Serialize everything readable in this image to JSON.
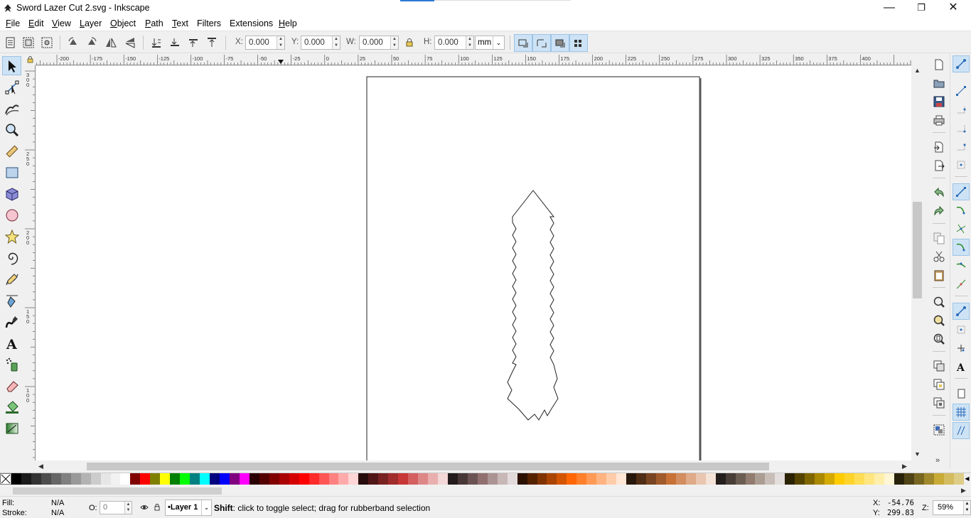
{
  "window": {
    "title": "Sword Lazer Cut 2.svg - Inkscape",
    "minimize_glyph": "—",
    "maximize_glyph": "❐",
    "close_glyph": "✕"
  },
  "menu": [
    {
      "label": "File",
      "key": "F",
      "rest": "ile"
    },
    {
      "label": "Edit",
      "key": "E",
      "rest": "dit"
    },
    {
      "label": "View",
      "key": "V",
      "rest": "iew"
    },
    {
      "label": "Layer",
      "key": "L",
      "rest": "ayer"
    },
    {
      "label": "Object",
      "key": "O",
      "rest": "bject"
    },
    {
      "label": "Path",
      "key": "P",
      "rest": "ath"
    },
    {
      "label": "Text",
      "key": "T",
      "rest": "ext"
    },
    {
      "label": "Filters",
      "key": "",
      "rest": "Filters"
    },
    {
      "label": "Extensions",
      "key": "",
      "rest": "Extensions"
    },
    {
      "label": "Help",
      "key": "H",
      "rest": "elp"
    }
  ],
  "toolbar": {
    "x_label": "X:",
    "x_value": "0.000",
    "y_label": "Y:",
    "y_value": "0.000",
    "w_label": "W:",
    "w_value": "0.000",
    "h_label": "H:",
    "h_value": "0.000",
    "unit": "mm",
    "spin_arrows": "▲\n▼",
    "dropdown_glyph": "⌄"
  },
  "rulers": {
    "h_ticks": [
      "-200",
      "-175",
      "-150",
      "-125",
      "-100",
      "-75",
      "-50",
      "-25",
      "0",
      "25",
      "50",
      "75",
      "100",
      "125",
      "150",
      "175",
      "200",
      "225",
      "250",
      "275",
      "300",
      "325",
      "350",
      "375",
      "400"
    ],
    "v_ticks": [
      "300",
      "250",
      "200",
      "150",
      "100"
    ]
  },
  "scroll": {
    "up": "▲",
    "down": "▼",
    "left": "◀",
    "right": "▶"
  },
  "toolbox_more": "»",
  "cmd_more": "»",
  "palette": {
    "colors": [
      "#000000",
      "#1a1a1a",
      "#333333",
      "#4d4d4d",
      "#666666",
      "#808080",
      "#999999",
      "#b3b3b3",
      "#cccccc",
      "#e6e6e6",
      "#f2f2f2",
      "#ffffff",
      "#800000",
      "#ff0000",
      "#808000",
      "#ffff00",
      "#008000",
      "#00ff00",
      "#008080",
      "#00ffff",
      "#000080",
      "#0000ff",
      "#800080",
      "#ff00ff",
      "#2b0000",
      "#550000",
      "#800000",
      "#aa0000",
      "#d40000",
      "#ff0000",
      "#ff2a2a",
      "#ff5555",
      "#ff8080",
      "#ffaaaa",
      "#ffd5d5",
      "#280b0b",
      "#501616",
      "#782121",
      "#a02c2c",
      "#c83737",
      "#d35f5f",
      "#de8787",
      "#e9afaf",
      "#f4d7d7",
      "#241c1c",
      "#483737",
      "#6c5353",
      "#916f6f",
      "#ac9393",
      "#c8b7b7",
      "#e3dbdb",
      "#2b1100",
      "#552200",
      "#803300",
      "#aa4400",
      "#d45500",
      "#ff6600",
      "#ff7f2a",
      "#ff9955",
      "#ffb380",
      "#ffccaa",
      "#ffe6d5",
      "#28170b",
      "#502d16",
      "#784421",
      "#a05a2c",
      "#c87137",
      "#d38d5f",
      "#deaa87",
      "#e9c6af",
      "#f4e3d7",
      "#241f1c",
      "#483e37",
      "#6c5d53",
      "#917c6f",
      "#ac9d93",
      "#c8beb7",
      "#e3dedb",
      "#2b2200",
      "#554400",
      "#806600",
      "#aa8800",
      "#d4aa00",
      "#ffcc00",
      "#ffd42a",
      "#ffdd55",
      "#ffe680",
      "#ffeeaa",
      "#fff6d5",
      "#28220b",
      "#504416",
      "#786721",
      "#a0892c",
      "#c8ab37",
      "#d3bc5f",
      "#decd87"
    ],
    "end_arrow": "◀"
  },
  "status": {
    "fill_label": "Fill:",
    "fill_value": "N/A",
    "stroke_label": "Stroke:",
    "stroke_value": "N/A",
    "opacity_label": "O:",
    "opacity_value": "0",
    "layer_name": "•Layer 1",
    "message_key": "Shift",
    "message_rest": ": click to toggle select; drag for rubberband selection",
    "x_label": "X:",
    "x_value": "-54.76",
    "y_label": "Y:",
    "y_value": "299.83",
    "zoom_label": "Z:",
    "zoom_value": "59%"
  },
  "icons": {
    "app": "inkscape-logo-icon",
    "lock": "lock-icon",
    "layer_eye": "eye-icon",
    "layer_lock": "padlock-icon"
  }
}
